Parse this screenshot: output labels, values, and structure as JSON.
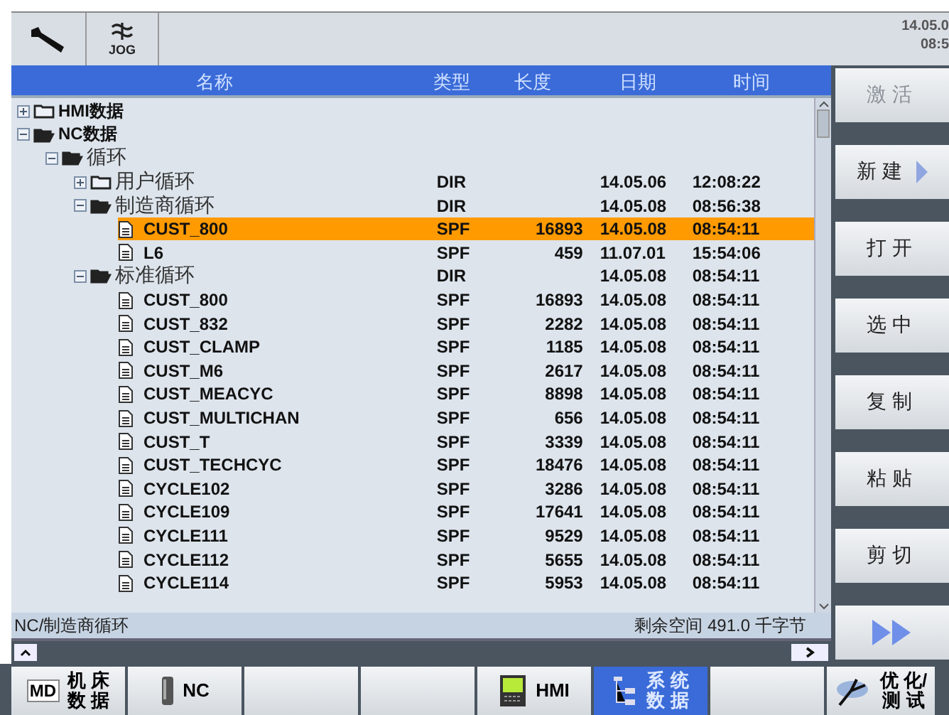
{
  "top_bar": {
    "mode": "JOG",
    "date": "14.05.0",
    "time": "08:5"
  },
  "columns": [
    "名称",
    "类型",
    "长度",
    "日期",
    "时间"
  ],
  "tree": [
    {
      "kind": "folder",
      "name": "HMI数据",
      "expanded": false,
      "selected": false
    },
    {
      "kind": "folder",
      "name": "NC数据",
      "expanded": true,
      "selected": false,
      "children": [
        {
          "kind": "folder",
          "name": "循环",
          "expanded": true,
          "selected": false,
          "children": [
            {
              "kind": "folder",
              "name": "用户循环",
              "expanded": false,
              "selected": false,
              "type": "DIR",
              "date": "14.05.06",
              "time": "12:08:22"
            },
            {
              "kind": "folder",
              "name": "制造商循环",
              "expanded": true,
              "selected": false,
              "type": "DIR",
              "date": "14.05.08",
              "time": "08:56:38",
              "children": [
                {
                  "kind": "file",
                  "name": "CUST_800",
                  "selected": true,
                  "type": "SPF",
                  "length": "16893",
                  "date": "14.05.08",
                  "time": "08:54:11"
                },
                {
                  "kind": "file",
                  "name": "L6",
                  "selected": false,
                  "type": "SPF",
                  "length": "459",
                  "date": "11.07.01",
                  "time": "15:54:06"
                }
              ]
            },
            {
              "kind": "folder",
              "name": "标准循环",
              "expanded": true,
              "selected": false,
              "type": "DIR",
              "date": "14.05.08",
              "time": "08:54:11",
              "children": [
                {
                  "kind": "file",
                  "name": "CUST_800",
                  "selected": false,
                  "type": "SPF",
                  "length": "16893",
                  "date": "14.05.08",
                  "time": "08:54:11"
                },
                {
                  "kind": "file",
                  "name": "CUST_832",
                  "selected": false,
                  "type": "SPF",
                  "length": "2282",
                  "date": "14.05.08",
                  "time": "08:54:11"
                },
                {
                  "kind": "file",
                  "name": "CUST_CLAMP",
                  "selected": false,
                  "type": "SPF",
                  "length": "1185",
                  "date": "14.05.08",
                  "time": "08:54:11"
                },
                {
                  "kind": "file",
                  "name": "CUST_M6",
                  "selected": false,
                  "type": "SPF",
                  "length": "2617",
                  "date": "14.05.08",
                  "time": "08:54:11"
                },
                {
                  "kind": "file",
                  "name": "CUST_MEACYC",
                  "selected": false,
                  "type": "SPF",
                  "length": "8898",
                  "date": "14.05.08",
                  "time": "08:54:11"
                },
                {
                  "kind": "file",
                  "name": "CUST_MULTICHAN",
                  "selected": false,
                  "type": "SPF",
                  "length": "656",
                  "date": "14.05.08",
                  "time": "08:54:11"
                },
                {
                  "kind": "file",
                  "name": "CUST_T",
                  "selected": false,
                  "type": "SPF",
                  "length": "3339",
                  "date": "14.05.08",
                  "time": "08:54:11"
                },
                {
                  "kind": "file",
                  "name": "CUST_TECHCYC",
                  "selected": false,
                  "type": "SPF",
                  "length": "18476",
                  "date": "14.05.08",
                  "time": "08:54:11"
                },
                {
                  "kind": "file",
                  "name": "CYCLE102",
                  "selected": false,
                  "type": "SPF",
                  "length": "3286",
                  "date": "14.05.08",
                  "time": "08:54:11"
                },
                {
                  "kind": "file",
                  "name": "CYCLE109",
                  "selected": false,
                  "type": "SPF",
                  "length": "17641",
                  "date": "14.05.08",
                  "time": "08:54:11"
                },
                {
                  "kind": "file",
                  "name": "CYCLE111",
                  "selected": false,
                  "type": "SPF",
                  "length": "9529",
                  "date": "14.05.08",
                  "time": "08:54:11"
                },
                {
                  "kind": "file",
                  "name": "CYCLE112",
                  "selected": false,
                  "type": "SPF",
                  "length": "5655",
                  "date": "14.05.08",
                  "time": "08:54:11"
                },
                {
                  "kind": "file",
                  "name": "CYCLE114",
                  "selected": false,
                  "type": "SPF",
                  "length": "5953",
                  "date": "14.05.08",
                  "time": "08:54:11"
                }
              ]
            }
          ]
        }
      ]
    }
  ],
  "status": {
    "path": "NC/制造商循环",
    "free_space": "剩余空间 491.0 千字节"
  },
  "softkeys_right": [
    {
      "kind": "text",
      "label": "激活",
      "disabled": true
    },
    {
      "kind": "menu",
      "label": "新建",
      "disabled": false
    },
    {
      "kind": "text",
      "label": "打开",
      "disabled": false
    },
    {
      "kind": "text",
      "label": "选中",
      "disabled": false
    },
    {
      "kind": "text",
      "label": "复制",
      "disabled": false
    },
    {
      "kind": "text",
      "label": "粘贴",
      "disabled": false
    },
    {
      "kind": "text",
      "label": "剪切",
      "disabled": false
    },
    {
      "kind": "forward",
      "disabled": false
    }
  ],
  "softkeys_bottom": [
    {
      "kind": "badge",
      "badge": "MD",
      "lines": [
        "机 床",
        "数 据"
      ],
      "selected": false
    },
    {
      "kind": "device",
      "lines": [
        "NC"
      ],
      "selected": false
    },
    {
      "kind": "blank",
      "selected": false
    },
    {
      "kind": "blank",
      "selected": false
    },
    {
      "kind": "monitor",
      "lines": [
        "HMI"
      ],
      "selected": false
    },
    {
      "kind": "tree",
      "lines": [
        "系 统",
        "数 据"
      ],
      "selected": true
    },
    {
      "kind": "blank",
      "selected": false
    },
    {
      "kind": "probe",
      "lines": [
        "优 化/",
        "测 试"
      ],
      "selected": false
    }
  ]
}
